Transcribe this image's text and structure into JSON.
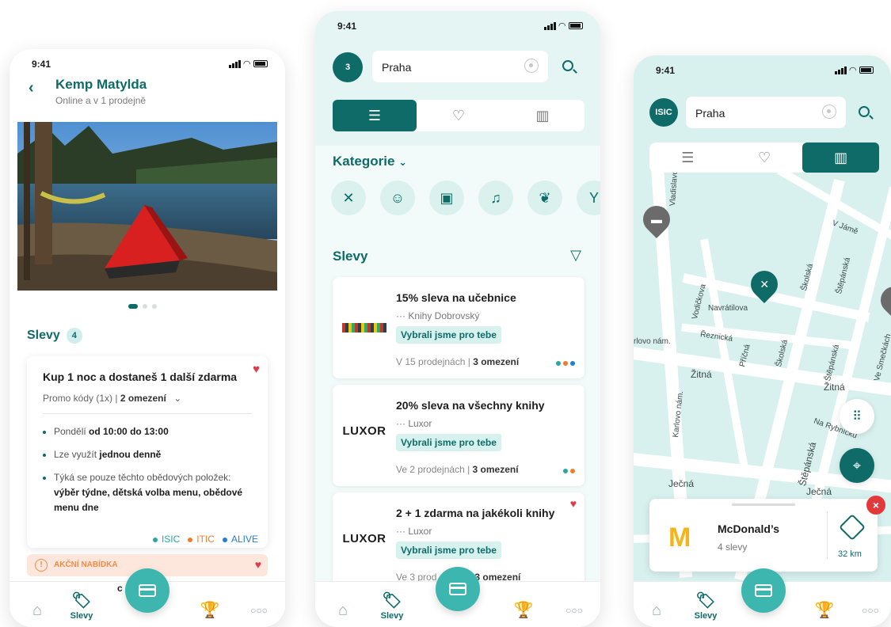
{
  "phone1": {
    "status_time": "9:41",
    "title": "Kemp Matylda",
    "subtitle": "Online a v 1 prodejně",
    "section_title": "Slevy",
    "section_count": "4",
    "card": {
      "title": "Kup 1 noc a dostaneš 1 další zdarma",
      "promo": "Promo kódy (1x) | ",
      "promo_bold": "2 omezení",
      "b1_prefix": "Pondělí ",
      "b1_bold": "od 10:00 do 13:00",
      "b2_prefix": "Lze využít ",
      "b2_bold": "jednou denně",
      "b3_prefix": "Týká se pouze těchto obědových položek:",
      "b3_bold": "výběr týdne, dětská volba menu, obědové menu dne",
      "tags": [
        {
          "label": "ISIC",
          "color": "#2aa8a0"
        },
        {
          "label": "ITIC",
          "color": "#f07e26"
        },
        {
          "label": "ALIVE",
          "color": "#1e7fd6"
        }
      ]
    },
    "action_label": "AKČNÍ NABÍDKA",
    "action_peek": "c",
    "tabs": {
      "active": "Slevy"
    }
  },
  "phone2": {
    "status_time": "9:41",
    "logo_text": "3",
    "search_text": "Praha",
    "category_title": "Kategorie",
    "discounts_title": "Slevy",
    "deals": [
      {
        "title": "15% sleva na učebnice",
        "shop": "Knihy Dobrovský",
        "logo": "",
        "pill": "Vybrali jsme pro tebe",
        "meta_prefix": "V 15 prodejnách | ",
        "meta_bold": "3 omezení",
        "dots": [
          "#2aa8a0",
          "#f07e26",
          "#1e7fd6"
        ]
      },
      {
        "title": "20% sleva na všechny knihy",
        "shop": "Luxor",
        "logo": "LUXOR",
        "pill": "Vybrali jsme pro tebe",
        "meta_prefix": "Ve 2 prodejnách | ",
        "meta_bold": "3 omezení",
        "dots": [
          "#2aa8a0",
          "#f07e26"
        ]
      },
      {
        "title": "2 + 1 zdarma na jakékoli knihy",
        "shop": "Luxor",
        "logo": "LUXOR",
        "pill": "Vybrali jsme pro tebe",
        "meta_prefix": "Ve 3 prod",
        "meta_bold": "3 omezení",
        "dots": []
      }
    ],
    "tabs": {
      "active": "Slevy"
    }
  },
  "phone3": {
    "status_time": "9:41",
    "logo_text": "ISIC",
    "search_text": "Praha",
    "streets": {
      "vladislavova": "Vladislavova",
      "v_jame": "V Jámě",
      "stepanska1": "Štěpánská",
      "vodickova": "Vodičkova",
      "navratilova": "Navrátilova",
      "skolska1": "Školská",
      "reznicka": "Řeznická",
      "krovo_nam": "rlovo nám.",
      "pricna": "Příčná",
      "skolska2": "Školská",
      "stepanska2": "Štěpánská",
      "ve_smeckach": "Ve Smečkách",
      "zitna1": "Žitná",
      "zitna2": "Žitná",
      "karlovo_nam": "Karlovo nám.",
      "na_rybnicku": "Na Rybníčku",
      "stepanska3": "Štěpánská",
      "jecna1": "Ječná",
      "jecna2": "Ječná"
    },
    "place": {
      "name": "McDonald’s",
      "offers": "4 slevy",
      "distance": "32 km"
    },
    "tabs": {
      "active": "Slevy"
    }
  }
}
